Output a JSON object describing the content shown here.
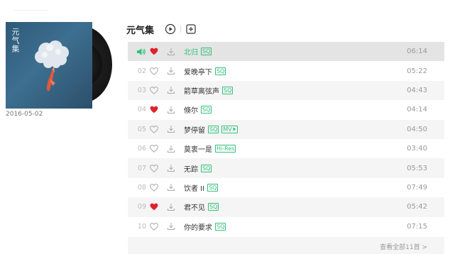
{
  "album": {
    "cover_title": "元气集",
    "release_date": "2016-05-02"
  },
  "header": {
    "title": "元气集"
  },
  "colors": {
    "accent": "#31c27c",
    "heart_red": "#e0212c",
    "text_gray": "#999999"
  },
  "tracks": [
    {
      "index": "",
      "title": "北归",
      "tags": [
        "SQ"
      ],
      "duration": "06:14",
      "liked": true,
      "playing": true
    },
    {
      "index": "02",
      "title": "爱晚亭下",
      "tags": [
        "SQ"
      ],
      "duration": "05:22",
      "liked": false,
      "playing": false
    },
    {
      "index": "03",
      "title": "箭草离弦声",
      "tags": [
        "SQ"
      ],
      "duration": "04:43",
      "liked": false,
      "playing": false
    },
    {
      "index": "04",
      "title": "倏尔",
      "tags": [
        "SQ"
      ],
      "duration": "04:14",
      "liked": true,
      "playing": false
    },
    {
      "index": "05",
      "title": "梦停留",
      "tags": [
        "SQ",
        "MV"
      ],
      "duration": "04:50",
      "liked": false,
      "playing": false
    },
    {
      "index": "06",
      "title": "莫衷一是",
      "tags": [
        "Hi-Res"
      ],
      "duration": "03:40",
      "liked": false,
      "playing": false
    },
    {
      "index": "07",
      "title": "无踪",
      "tags": [
        "SQ"
      ],
      "duration": "05:53",
      "liked": false,
      "playing": false
    },
    {
      "index": "08",
      "title": "饮者 II",
      "tags": [
        "SQ"
      ],
      "duration": "07:49",
      "liked": false,
      "playing": false
    },
    {
      "index": "09",
      "title": "君不见",
      "tags": [
        "SQ"
      ],
      "duration": "05:42",
      "liked": true,
      "playing": false
    },
    {
      "index": "10",
      "title": "你的要求",
      "tags": [
        "SQ"
      ],
      "duration": "07:15",
      "liked": false,
      "playing": false
    }
  ],
  "footer": {
    "view_all_label": "查看全部11首 >"
  }
}
